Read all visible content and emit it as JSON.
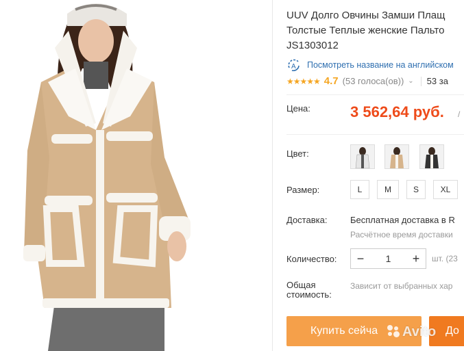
{
  "product": {
    "title_line1": "UUV Долго Овчины Замши Плащ",
    "title_line2": "Толстые Теплые женские Пальто",
    "title_line3": "JS1303012",
    "translate_link": "Посмотреть название на английском",
    "rating": {
      "stars": "★★★★★",
      "value": "4.7",
      "votes": "(53 голоса(ов))",
      "orders": "53 за"
    },
    "price_label": "Цена:",
    "price": "3 562,64 руб.",
    "price_suffix": "/",
    "color_label": "Цвет:",
    "size_label": "Размер:",
    "sizes": [
      "L",
      "M",
      "S",
      "XL"
    ],
    "shipping_label": "Доставка:",
    "shipping_value": "Бесплатная доставка в R",
    "shipping_time": "Расчётное время доставки",
    "quantity_label": "Количество:",
    "quantity": {
      "minus": "−",
      "value": "1",
      "plus": "+",
      "unit": "шт. (23"
    },
    "total_label_1": "Общая",
    "total_label_2": "стоимость:",
    "total_value": "Зависит от выбранных хар",
    "buy_button": "Купить сейча",
    "cart_button": "До"
  },
  "watermark": "Avito",
  "colors": {
    "price": "#ee4b1a",
    "buy": "#f5a04a",
    "cart": "#f07a20",
    "link": "#2f6fb0",
    "star": "#f5a623"
  },
  "icons": {
    "translate": "translate-icon",
    "chevron": "chevron-down-icon"
  }
}
